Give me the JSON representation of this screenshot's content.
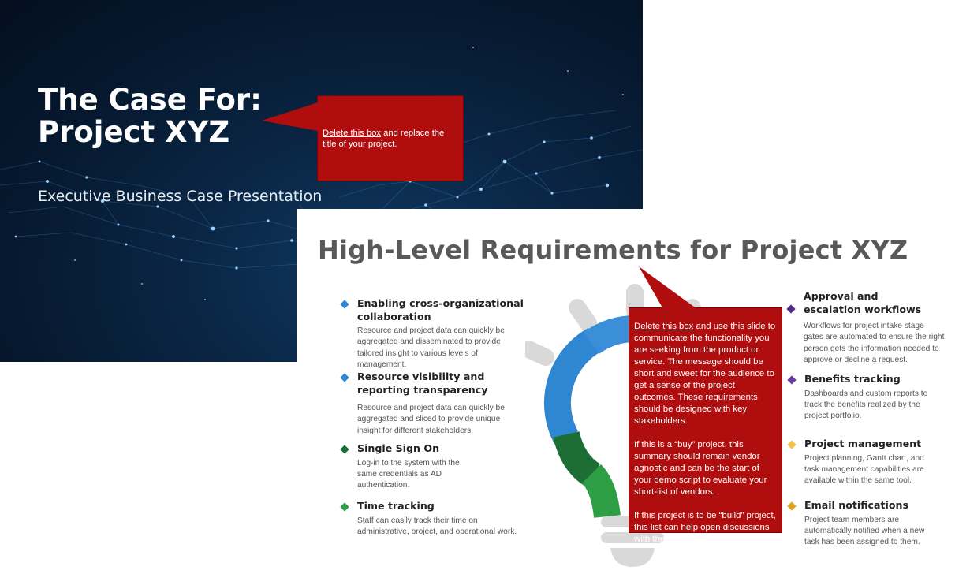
{
  "title_slide": {
    "title_line1": "The Case For:",
    "title_line2": "Project XYZ",
    "subtitle": "Executive Business Case Presentation",
    "note": {
      "link_text": "Delete this box",
      "text": " and replace the title of your project."
    }
  },
  "requirements_slide": {
    "title": "High-Level Requirements for Project XYZ",
    "left_items": [
      {
        "title": "Enabling cross-organizational collaboration",
        "description": "Resource and project data can quickly be aggregated and disseminated  to provide tailored insight to various levels of management.",
        "color": "#2f86d1"
      },
      {
        "title": "Resource visibility and reporting transparency",
        "description": "Resource and project data can quickly be aggregated and sliced to provide unique insight for different stakeholders.",
        "color": "#2f86d1"
      },
      {
        "title": "Single Sign On",
        "description": "Log-in to the system with the same credentials as AD authentication.",
        "color": "#1d6e35"
      },
      {
        "title": "Time tracking",
        "description": "Staff can easily track their time on administrative, project, and operational work.",
        "color": "#2e9e45"
      }
    ],
    "right_items": [
      {
        "title": "Approval and escalation workflows",
        "description": "Workflows for project intake stage gates are automated to ensure the right person gets the information needed to approve or decline a request.",
        "color": "#4f2d86"
      },
      {
        "title": "Benefits tracking",
        "description": "Dashboards and custom reports to track the benefits realized by the project portfolio.",
        "color": "#6b3aa0"
      },
      {
        "title": "Project management",
        "description": "Project planning, Gantt chart, and task management capabilities are available within the same tool.",
        "color": "#f0c24a"
      },
      {
        "title": "Email notifications",
        "description": "Project team members are automatically notified when a new task has been assigned to them.",
        "color": "#e0a020"
      }
    ],
    "note": {
      "link_text": "Delete this box",
      "para1_rest": " and use this slide to communicate the functionality you are seeking from the product or service. The message should be short and sweet for the audience to get a sense of the project outcomes. These requirements should be designed with key stakeholders.",
      "para2": "If this is a “buy” project, this summary should remain vendor agnostic and can be the start of your demo script to evaluate your short-list of vendors.",
      "para3": "If this project is to be “build” project, this list can help open discussions with the internal development team."
    }
  },
  "colors": {
    "callout_red": "#b00e0e",
    "title_slide_bg": "#06182e",
    "bulb_blue": "#2f86d1",
    "bulb_darkgreen": "#1d6e35",
    "bulb_green": "#2e9e45",
    "bulb_grey": "#d9d9d9"
  }
}
